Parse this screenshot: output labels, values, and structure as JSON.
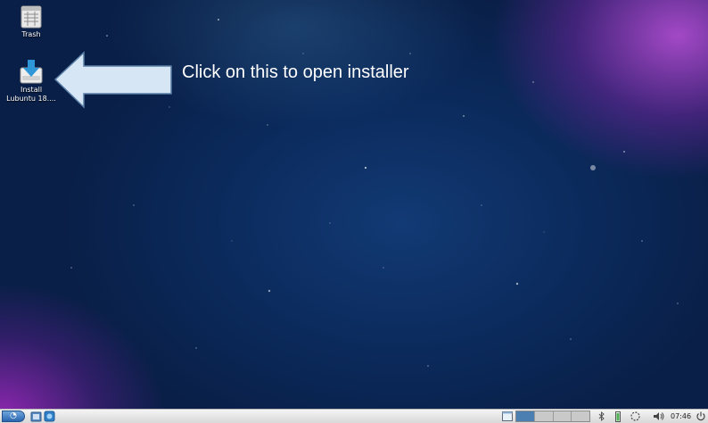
{
  "desktop": {
    "icons": [
      {
        "label": "Trash",
        "icon": "trash-icon"
      },
      {
        "label": "Install\nLubuntu 18....",
        "icon": "installer-icon"
      }
    ],
    "annotation": "Click on this to open installer"
  },
  "taskbar": {
    "clock": "07:46",
    "workspaces": 4,
    "active_workspace": 1,
    "tray_icons": [
      "show-desktop-icon",
      "bluetooth-icon",
      "battery-icon",
      "network-icon",
      "volume-icon",
      "power-icon"
    ]
  },
  "colors": {
    "desktop_base": "#0b2a5c",
    "accent_purple": "#a040d0",
    "taskbar": "#e4e4e4",
    "annotation_arrow": "#d6e6f5"
  }
}
